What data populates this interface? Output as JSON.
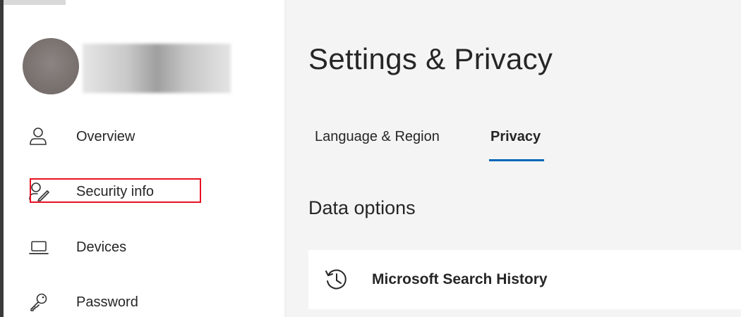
{
  "sidebar": {
    "nav": [
      {
        "label": "Overview",
        "icon": "person-icon"
      },
      {
        "label": "Security info",
        "icon": "person-edit-icon"
      },
      {
        "label": "Devices",
        "icon": "laptop-icon"
      },
      {
        "label": "Password",
        "icon": "key-icon"
      }
    ]
  },
  "main": {
    "title": "Settings & Privacy",
    "tabs": [
      {
        "label": "Language & Region"
      },
      {
        "label": "Privacy",
        "active": true
      }
    ],
    "section_title": "Data options",
    "card": {
      "label": "Microsoft Search History",
      "icon": "history-icon"
    }
  },
  "colors": {
    "accent": "#0067b8",
    "highlight": "#e81123",
    "main_bg": "#f4f4f4",
    "text": "#262626"
  }
}
